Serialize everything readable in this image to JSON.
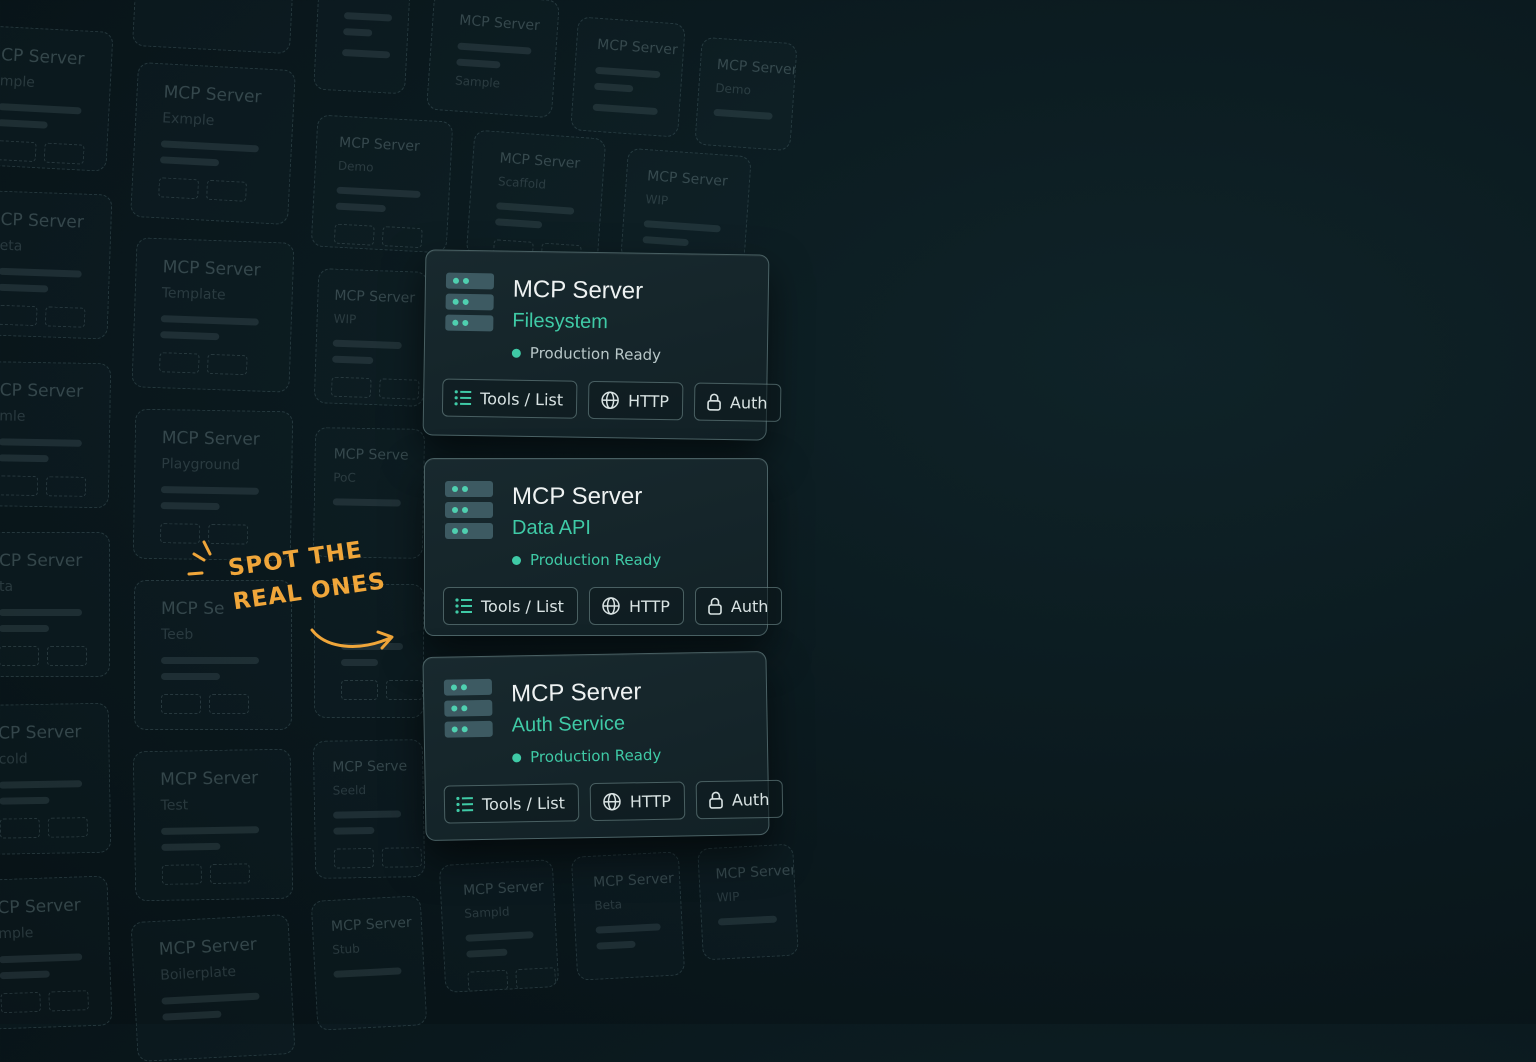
{
  "ghost_cards": [
    {
      "title": "CP Server",
      "subtitle": "mple"
    },
    {
      "title": "CP Server",
      "subtitle": "eta"
    },
    {
      "title": "CP Server",
      "subtitle": "mle"
    },
    {
      "title": "CP Server",
      "subtitle": "ta"
    },
    {
      "title": "CP Server",
      "subtitle": "cold"
    },
    {
      "title": "CP Server",
      "subtitle": "mple"
    },
    {
      "title": "MCP Server",
      "subtitle": "Exmple"
    },
    {
      "title": "MCP Server",
      "subtitle": "Template"
    },
    {
      "title": "MCP Server",
      "subtitle": "Playground"
    },
    {
      "title": "MCP Se",
      "subtitle": "Teeb"
    },
    {
      "title": "MCP Server",
      "subtitle": "Test"
    },
    {
      "title": "MCP Server",
      "subtitle": "Boilerplate"
    },
    {
      "title": "MCP Server",
      "subtitle": "Demo"
    },
    {
      "title": "MCP Server",
      "subtitle": "WIP"
    },
    {
      "title": "MCP Serve",
      "subtitle": "PoC"
    },
    {
      "title": "MCP Serve",
      "subtitle": "Seeld"
    },
    {
      "title": "MCP Server",
      "subtitle": "Stub"
    },
    {
      "title": "MCP Server",
      "subtitle": "Sample"
    },
    {
      "title": "MCP Server",
      "subtitle": "Scaffold"
    },
    {
      "title": "MCP Server",
      "subtitle": "Sampld"
    },
    {
      "title": "MCP Server",
      "subtitle": ""
    },
    {
      "title": "MCP Server",
      "subtitle": "WIP"
    },
    {
      "title": "MCP Server",
      "subtitle": "Beta"
    },
    {
      "title": "MCP Server",
      "subtitle": "Demo"
    },
    {
      "title": "MCP Server",
      "subtitle": "WIP"
    }
  ],
  "cards": [
    {
      "title": "MCP Server",
      "subtitle": "Filesystem",
      "status": "Production Ready",
      "tools_label": "Tools / List",
      "http_label": "HTTP",
      "auth_label": "Auth"
    },
    {
      "title": "MCP Server",
      "subtitle": "Data API",
      "status": "Production Ready",
      "tools_label": "Tools / List",
      "http_label": "HTTP",
      "auth_label": "Auth"
    },
    {
      "title": "MCP Server",
      "subtitle": "Auth Service",
      "status": "Production Ready",
      "tools_label": "Tools / List",
      "http_label": "HTTP",
      "auth_label": "Auth"
    }
  ],
  "annotation": {
    "line1": "SPOT THE",
    "line2": "REAL ONES"
  },
  "colors": {
    "accent": "#3fcaa6",
    "annotation": "#f0a63a",
    "background": "#0b1a1f"
  }
}
